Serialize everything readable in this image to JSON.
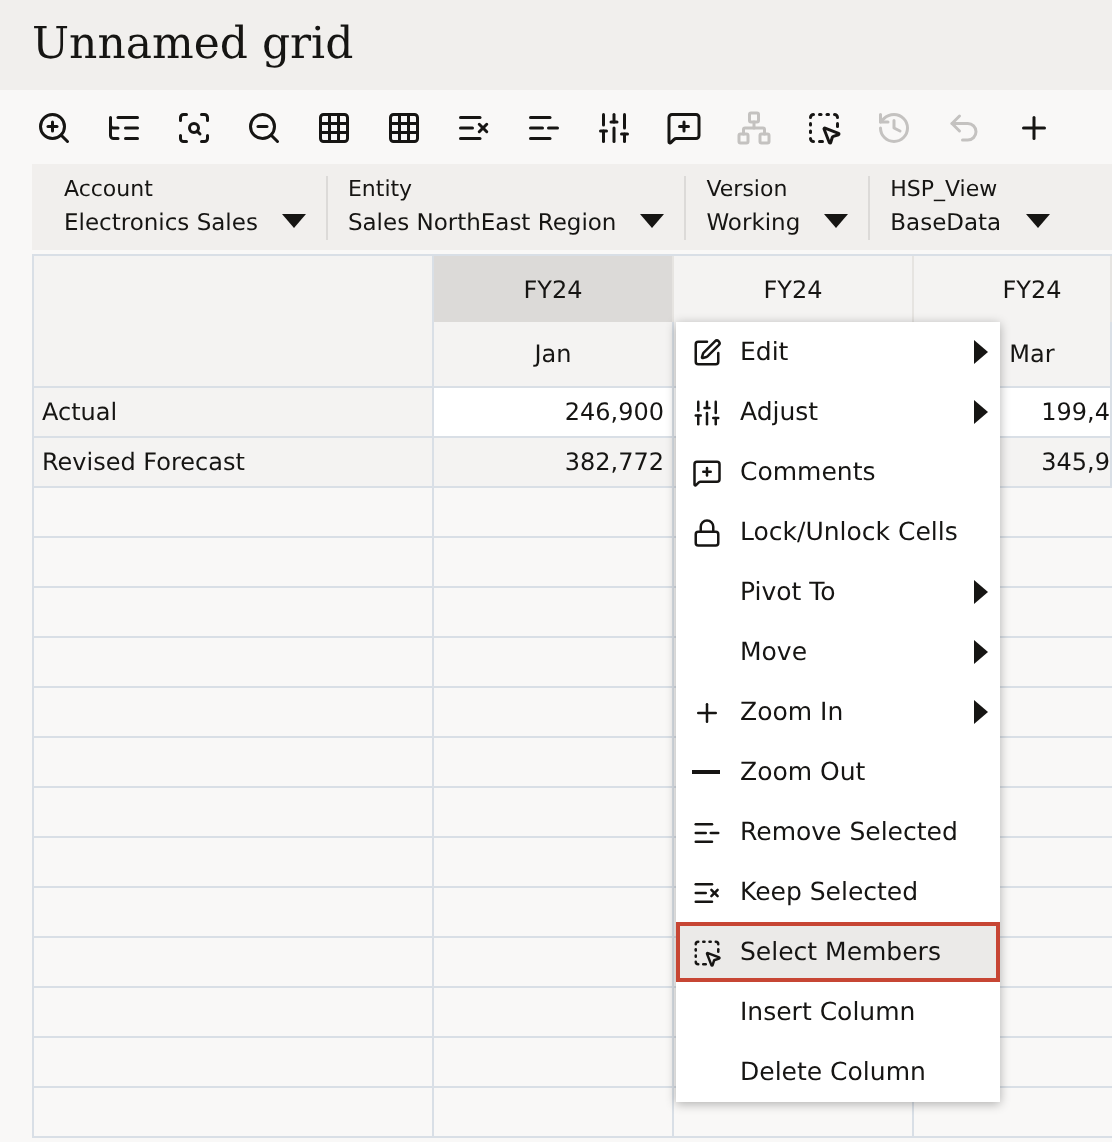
{
  "title": "Unnamed grid",
  "toolbar": [
    {
      "kind": "zoom-in",
      "disabled": false
    },
    {
      "kind": "tree",
      "disabled": false
    },
    {
      "kind": "zoom-select",
      "disabled": false
    },
    {
      "kind": "zoom-out",
      "disabled": false
    },
    {
      "kind": "grid",
      "disabled": false
    },
    {
      "kind": "grid",
      "disabled": false
    },
    {
      "kind": "keep",
      "disabled": false
    },
    {
      "kind": "remove",
      "disabled": false
    },
    {
      "kind": "adjust",
      "disabled": false
    },
    {
      "kind": "comment",
      "disabled": false
    },
    {
      "kind": "hierarchy",
      "disabled": true
    },
    {
      "kind": "select",
      "disabled": false
    },
    {
      "kind": "history",
      "disabled": true
    },
    {
      "kind": "undo",
      "disabled": true
    },
    {
      "kind": "plus",
      "disabled": false
    }
  ],
  "pov": [
    {
      "label": "Account",
      "value": "Electronics Sales"
    },
    {
      "label": "Entity",
      "value": "Sales NorthEast Region"
    },
    {
      "label": "Version",
      "value": "Working"
    },
    {
      "label": "HSP_View",
      "value": "BaseData"
    }
  ],
  "columns": [
    {
      "year": "FY24",
      "period": "Jan",
      "selected": true
    },
    {
      "year": "FY24",
      "selected": false
    },
    {
      "year": "FY24",
      "period": "Mar",
      "selected": false
    }
  ],
  "rows": [
    {
      "label": "Actual",
      "editable": true,
      "values": [
        "246,900",
        "199,4"
      ]
    },
    {
      "label": "Revised Forecast",
      "editable": false,
      "values": [
        "382,772",
        "345,9"
      ]
    }
  ],
  "context_menu": [
    {
      "label": "Edit",
      "kind": "edit",
      "submenu": true,
      "selected": false
    },
    {
      "label": "Adjust",
      "kind": "adjust",
      "submenu": true,
      "selected": false
    },
    {
      "label": "Comments",
      "kind": "comment",
      "submenu": false,
      "selected": false
    },
    {
      "label": "Lock/Unlock Cells",
      "kind": "lock",
      "submenu": false,
      "selected": false
    },
    {
      "label": "Pivot To",
      "submenu": true,
      "selected": false
    },
    {
      "label": "Move",
      "submenu": true,
      "selected": false
    },
    {
      "label": "Zoom In",
      "kind": "plus",
      "submenu": true,
      "selected": false
    },
    {
      "label": "Zoom Out",
      "kind": "minus",
      "submenu": false,
      "selected": false
    },
    {
      "label": "Remove Selected",
      "kind": "remove",
      "submenu": false,
      "selected": false
    },
    {
      "label": "Keep Selected",
      "kind": "keep",
      "submenu": false,
      "selected": false
    },
    {
      "label": "Select Members",
      "kind": "select",
      "submenu": false,
      "selected": true
    },
    {
      "label": "Insert Column",
      "submenu": false,
      "selected": false
    },
    {
      "label": "Delete Column",
      "submenu": false,
      "selected": false
    }
  ]
}
